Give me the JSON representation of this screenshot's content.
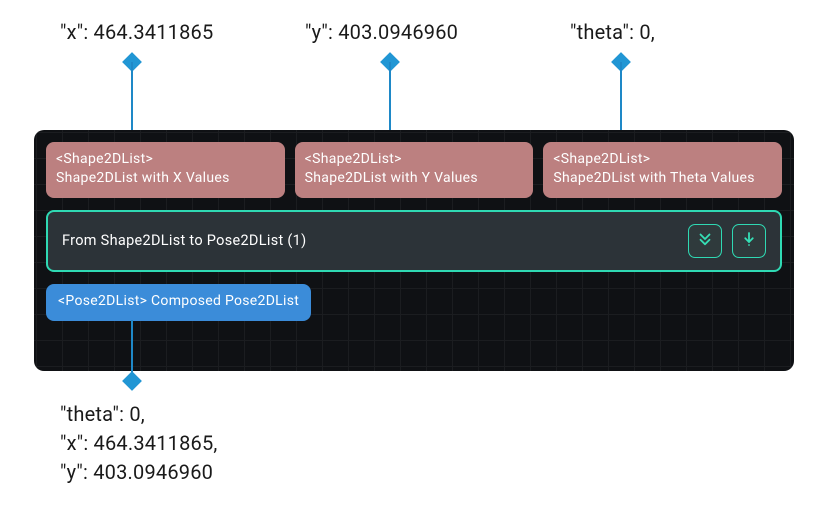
{
  "callouts": {
    "top": [
      {
        "text": "\"x\": 464.3411865"
      },
      {
        "text": "\"y\": 403.0946960"
      },
      {
        "text": "\"theta\": 0,"
      }
    ],
    "bottom": [
      "\"theta\": 0,",
      "\"x\": 464.3411865,",
      "\"y\": 403.0946960"
    ]
  },
  "node": {
    "inputs": [
      {
        "type": "<Shape2DList>",
        "label": "Shape2DList with X Values"
      },
      {
        "type": "<Shape2DList>",
        "label": "Shape2DList with Y Values"
      },
      {
        "type": "<Shape2DList>",
        "label": "Shape2DList with Theta Values"
      }
    ],
    "body": {
      "title": "From Shape2DList to Pose2DList (1)"
    },
    "output": {
      "type": "<Pose2DList>",
      "label": "Composed Pose2DList"
    }
  },
  "icons": {
    "collapse": "double-chevron-down",
    "execute": "download-arrow"
  }
}
